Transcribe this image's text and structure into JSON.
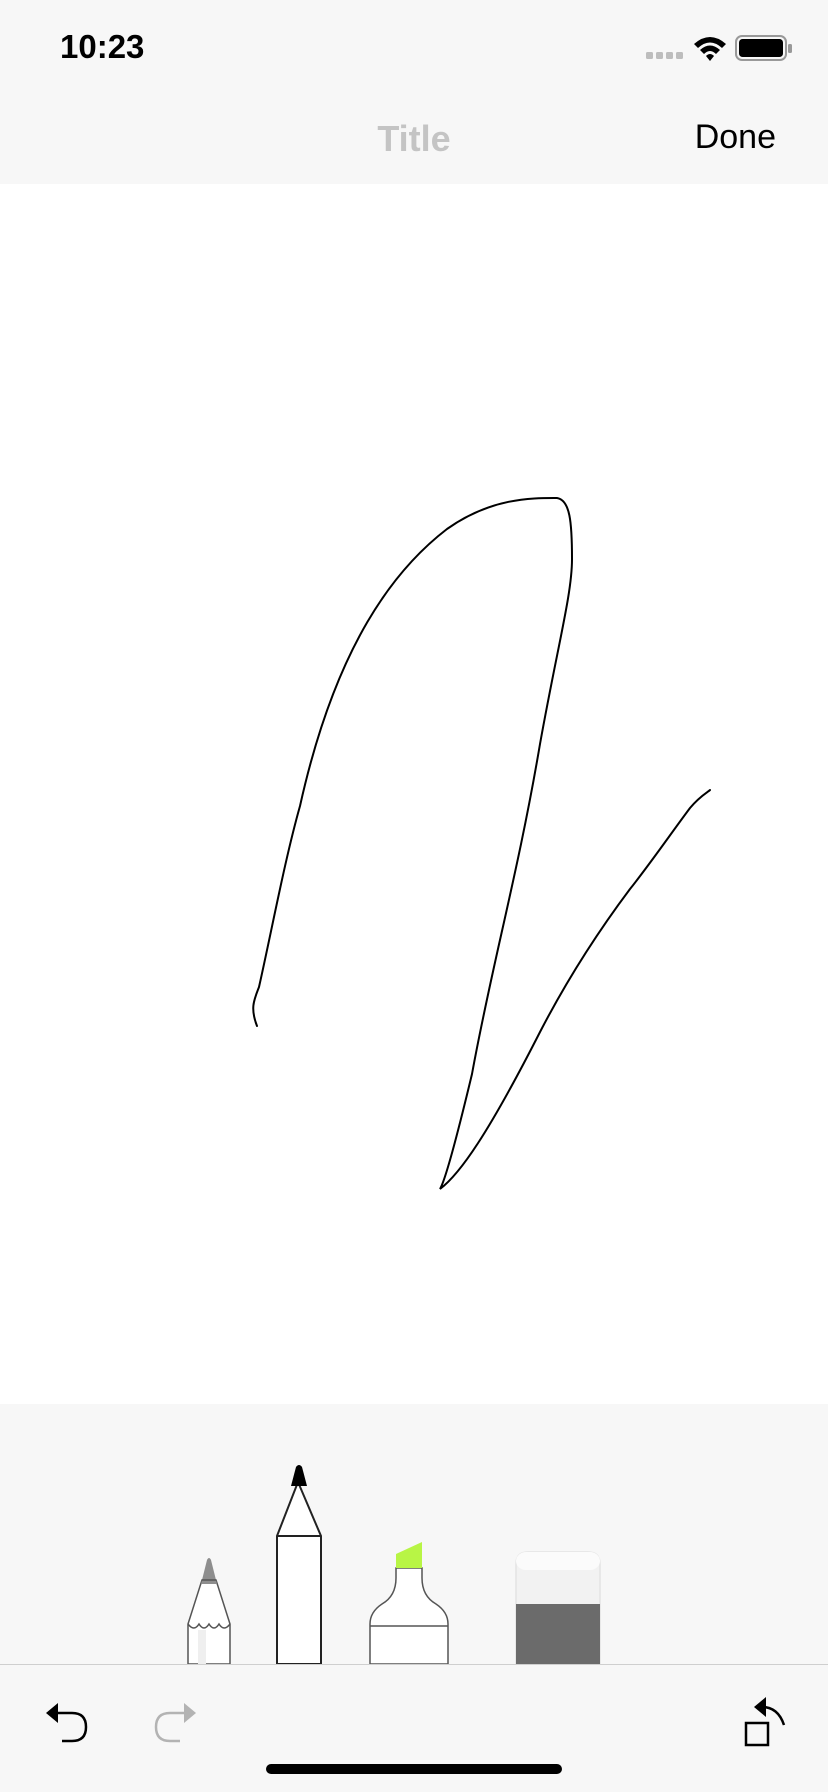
{
  "status_bar": {
    "time": "10:23",
    "icons": [
      "signal-icon",
      "wifi-icon",
      "battery-icon"
    ]
  },
  "nav": {
    "title_placeholder": "Title",
    "done_label": "Done"
  },
  "tools": [
    {
      "name": "pencil",
      "icon": "pencil-icon",
      "tip_color": "#8e8e8e"
    },
    {
      "name": "pen",
      "icon": "pen-icon",
      "tip_color": "#000000",
      "selected": true
    },
    {
      "name": "marker",
      "icon": "marker-icon",
      "tip_color": "#b8f545"
    },
    {
      "name": "eraser",
      "icon": "eraser-icon",
      "tip_color": "#6b6b6b"
    }
  ],
  "bottom_bar": {
    "undo_icon": "undo-icon",
    "redo_icon": "redo-icon",
    "redo_enabled": false,
    "rotate_icon": "rotate-icon"
  },
  "colors": {
    "bar_background": "#f7f7f7",
    "title_placeholder": "#c4c4c4",
    "ink": "#000000"
  }
}
